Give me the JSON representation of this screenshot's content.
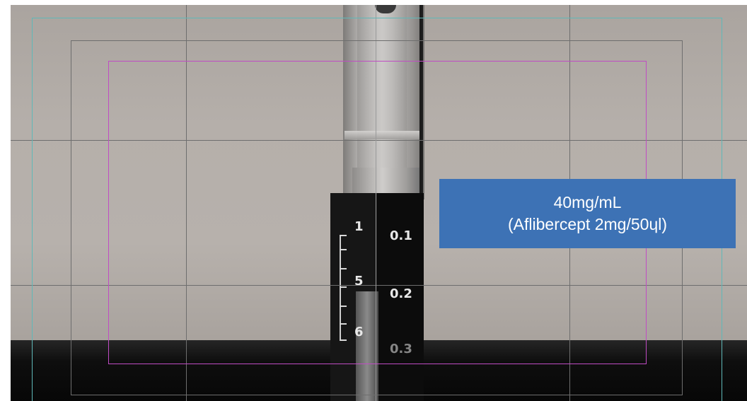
{
  "figure": {
    "description_type": "syringe close-up with dosing mark overlay"
  },
  "callout": {
    "line1": "40mg/mL",
    "line2": "(Aflibercept 2mg/50ɥl)",
    "background_color": "#3d72b5",
    "text_color": "#ffffff"
  },
  "scale": {
    "left_labels": [
      "1",
      "5",
      "6"
    ],
    "right_labels": [
      "0.1",
      "0.2",
      "0.3"
    ]
  },
  "guides": {
    "magenta_color": "#c04cc4",
    "teal_color": "#5fb8b8",
    "dark_color": "#6e6e6e"
  }
}
